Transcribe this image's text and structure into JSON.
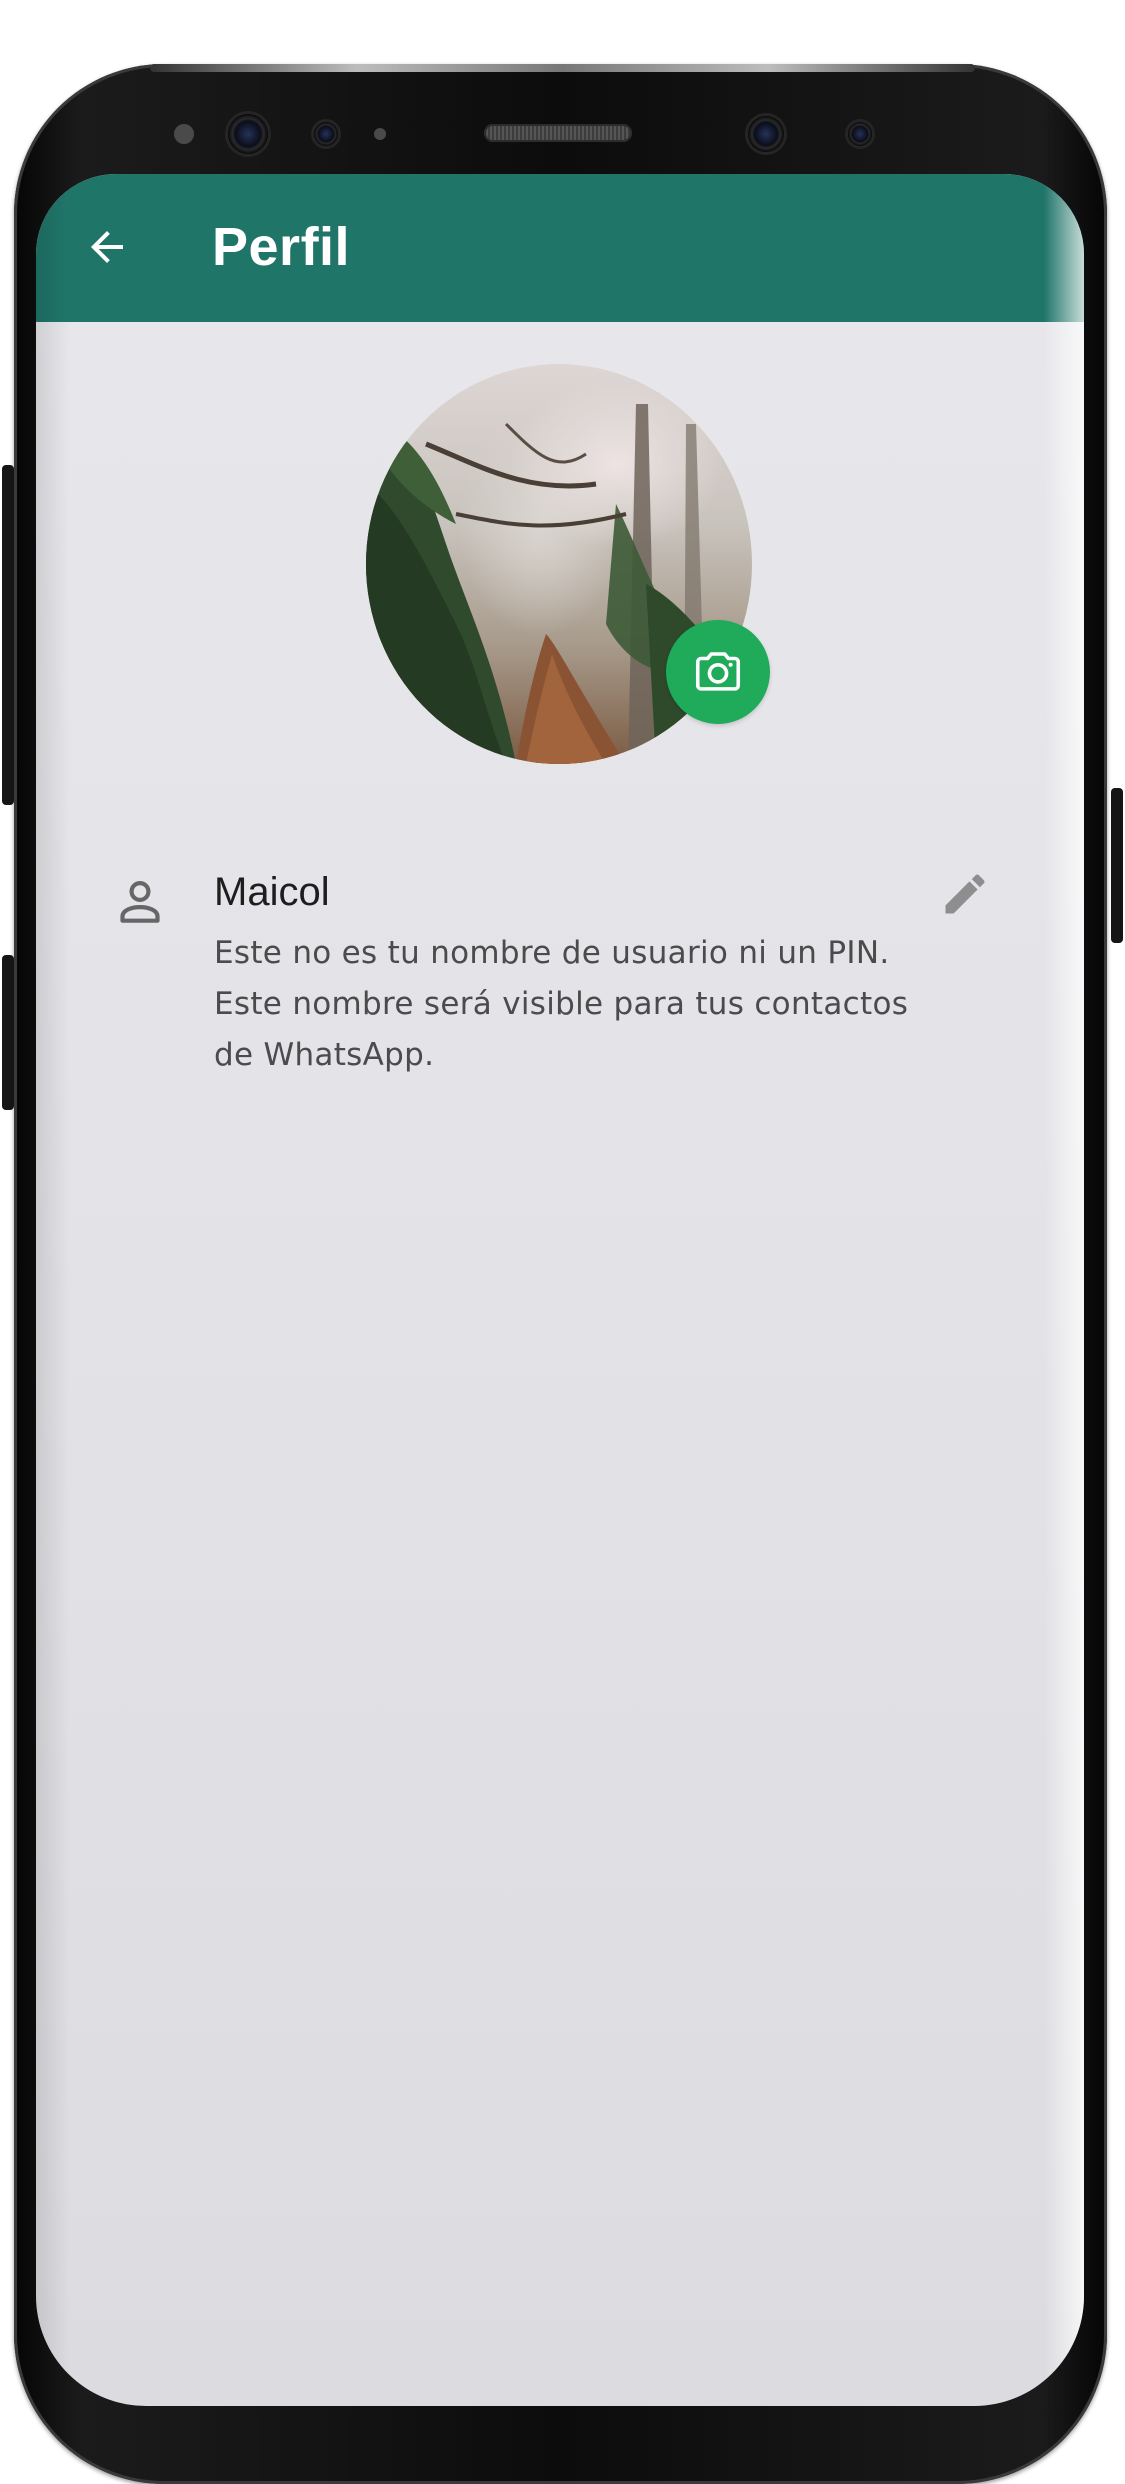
{
  "appbar": {
    "title": "Perfil",
    "back_icon": "arrow-left-icon",
    "background_color": "#207569"
  },
  "profile": {
    "avatar_description": "forest-path-photo",
    "camera_icon": "camera-icon",
    "camera_button_color": "#1fab5a"
  },
  "name_section": {
    "icon": "person-icon",
    "name": "Maicol",
    "description": "Este no es tu nombre de usuario ni un PIN. Este nombre será visible para tus contactos de WhatsApp.",
    "edit_icon": "pencil-icon"
  }
}
